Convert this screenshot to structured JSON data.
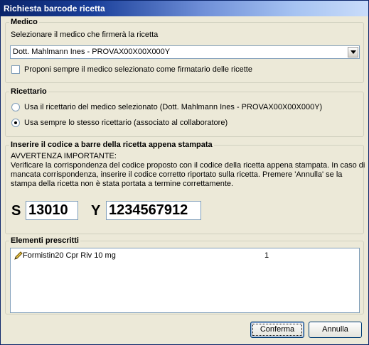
{
  "window": {
    "title": "Richiesta barcode ricetta",
    "title_colors": [
      "#0a246a",
      "#3d66c4",
      "#a6c3f2"
    ]
  },
  "medico": {
    "legend": "Medico",
    "instruction": "Selezionare il medico che firmerà la ricetta",
    "selected": "Dott. Mahlmann Ines - PROVAX00X00X000Y",
    "checkbox_label": "Proponi sempre il medico selezionato come firmatario delle ricette",
    "checkbox_checked": false
  },
  "ricettario": {
    "legend": "Ricettario",
    "option1": "Usa il ricettario del medico selezionato (Dott. Mahlmann Ines - PROVAX00X00X000Y)",
    "option2": "Usa sempre lo stesso ricettario (associato al collaboratore)",
    "selected_option": 2
  },
  "barcode": {
    "legend": "Inserire il codice a barre della ricetta appena stampata",
    "warning_title": "AVVERTENZA IMPORTANTE:",
    "warning_line1": "Verificare la corrispondenza del codice proposto con il codice della ricetta appena stampata. In caso di",
    "warning_line2": "mancata corrispondenza, inserire il codice corretto riportato sulla ricetta. Premere 'Annulla' se la",
    "warning_line3": "stampa della ricetta non è stata portata a termine correttamente.",
    "s_label": "S",
    "s_value": "13010",
    "y_label": "Y",
    "y_value": "1234567912"
  },
  "elementi": {
    "legend": "Elementi prescritti",
    "items": [
      {
        "icon": "pencil-icon",
        "name": "Formistin20 Cpr Riv 10 mg",
        "qty": "1"
      }
    ]
  },
  "buttons": {
    "confirm": "Conferma",
    "cancel": "Annulla"
  }
}
